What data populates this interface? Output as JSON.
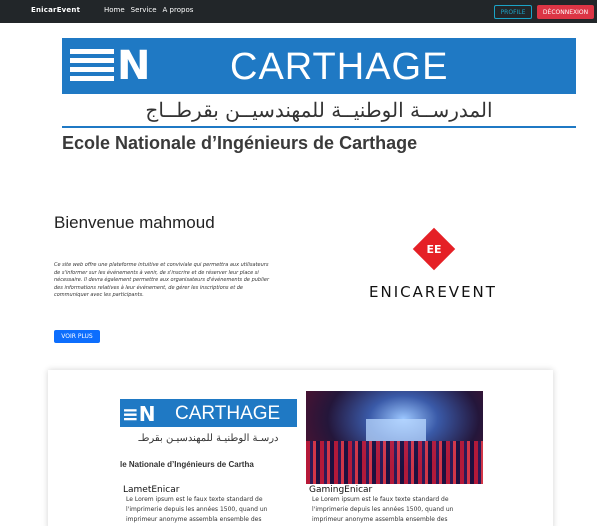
{
  "navbar": {
    "brand": "EnicarEvent",
    "links": [
      "Home",
      "Service",
      "A propos"
    ],
    "profile_label": "PROFILE",
    "logout_label": "DÉCONNEXION"
  },
  "logo": {
    "main_word": "CARTHAGE",
    "arabic": "المدرســة الوطنيــة للمهندسيــن بقرطــاج",
    "french": "Ecole Nationale d’Ingénieurs de Carthage"
  },
  "hero": {
    "welcome": "Bienvenue mahmoud",
    "description": "Ce site web offre une plateforme intuitive et conviviale qui permettra aux utilisateurs de s'informer sur les événements à venir, de s'inscrire et de réserver leur place si nécessaire. Il devra également permettre aux organisateurs d'événements de publier des informations relatives à leur événement, de gérer les inscriptions et de communiquer avec les participants.",
    "more_label": "VOIR PLUS",
    "brand_badge": "EE",
    "brand_name": "ENICAREVENT"
  },
  "cards": [
    {
      "title": "LametEnicar",
      "text": "Le Lorem ipsum est le faux texte standard de l'imprimerie depuis les années 1500, quand un imprimeur anonyme assembla ensemble des",
      "image_logo": {
        "main_word": "CARTHAGE",
        "arabic": "درسـة الوطنيـة للمهندسيـن بقرطـ",
        "french": "le Nationale d’Ingénieurs de Cartha"
      }
    },
    {
      "title": "GamingEnicar",
      "text": "Le Lorem ipsum est le faux texte standard de l'imprimerie depuis les années 1500, quand un imprimeur anonyme assembla ensemble des"
    }
  ],
  "colors": {
    "navbar_bg": "#222629",
    "logo_blue": "#1f79c4",
    "profile": "#1ba3c6",
    "logout": "#dc3545",
    "primary": "#0d6efd",
    "badge_red": "#e52026"
  }
}
